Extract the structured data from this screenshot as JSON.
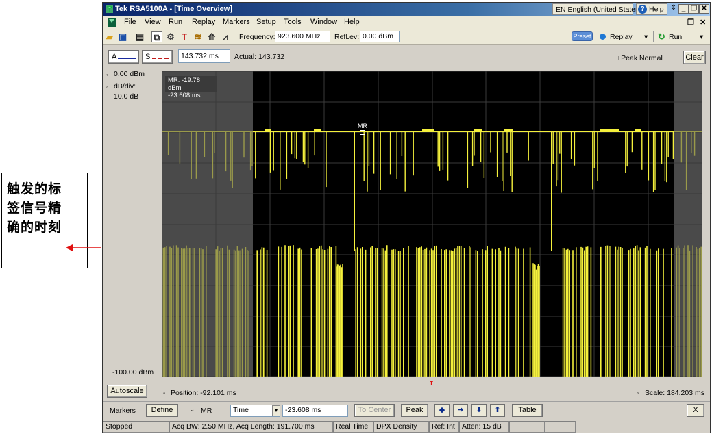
{
  "annotation": {
    "lines": [
      "触发的标",
      "签信号精",
      "确的时刻"
    ]
  },
  "window": {
    "title": "Tek RSA5100A - [Time Overview]",
    "language": "EN English (United States)",
    "help_label": "Help"
  },
  "menu": {
    "items": [
      "File",
      "View",
      "Run",
      "Replay",
      "Markers",
      "Setup",
      "Tools",
      "Window",
      "Help"
    ]
  },
  "toolbar": {
    "frequency_label": "Frequency:",
    "frequency_value": "923.600 MHz",
    "reflev_label": "RefLev:",
    "reflev_value": "0.00 dBm",
    "preset_label": "Preset",
    "replay_label": "Replay",
    "run_label": "Run"
  },
  "trace_header": {
    "trace_a_label": "A",
    "trace_s_label": "S",
    "time_value": "143.732 ms",
    "actual_label": "Actual:  143.732",
    "detection_label": "+Peak Normal",
    "clear_label": "Clear"
  },
  "plot": {
    "ref_level": "0.00 dBm",
    "db_per_div_label": "dB/div:",
    "db_per_div_value": "10.0 dB",
    "bottom_level": "-100.00 dBm",
    "marker_readout_1": "MR: -19.78 dBm",
    "marker_readout_2": "-23.608 ms",
    "marker_label": "MR",
    "trigger_label": "T",
    "colors": {
      "trace": "#f4f03c",
      "trace_dim": "#9a9a4a",
      "grid": "#3a3a3a",
      "red_bar": "#e01010",
      "blue_bar": "#1010d8"
    }
  },
  "status_line": {
    "autoscale_label": "Autoscale",
    "position_label": "Position:  -92.101 ms",
    "scale_label": "Scale:  184.203 ms"
  },
  "markers_bar": {
    "markers_label": "Markers",
    "define_label": "Define",
    "marker_select": "MR",
    "type_select": "Time",
    "time_value": "-23.608 ms",
    "to_center_label": "To Center",
    "peak_label": "Peak",
    "table_label": "Table",
    "close_label": "X"
  },
  "status_bar": {
    "state": "Stopped",
    "acq": "Acq BW: 2.50 MHz, Acq Length: 191.700 ms",
    "mode": "Real Time",
    "display": "DPX Density",
    "ref": "Ref: Int",
    "atten": "Atten: 15 dB"
  }
}
